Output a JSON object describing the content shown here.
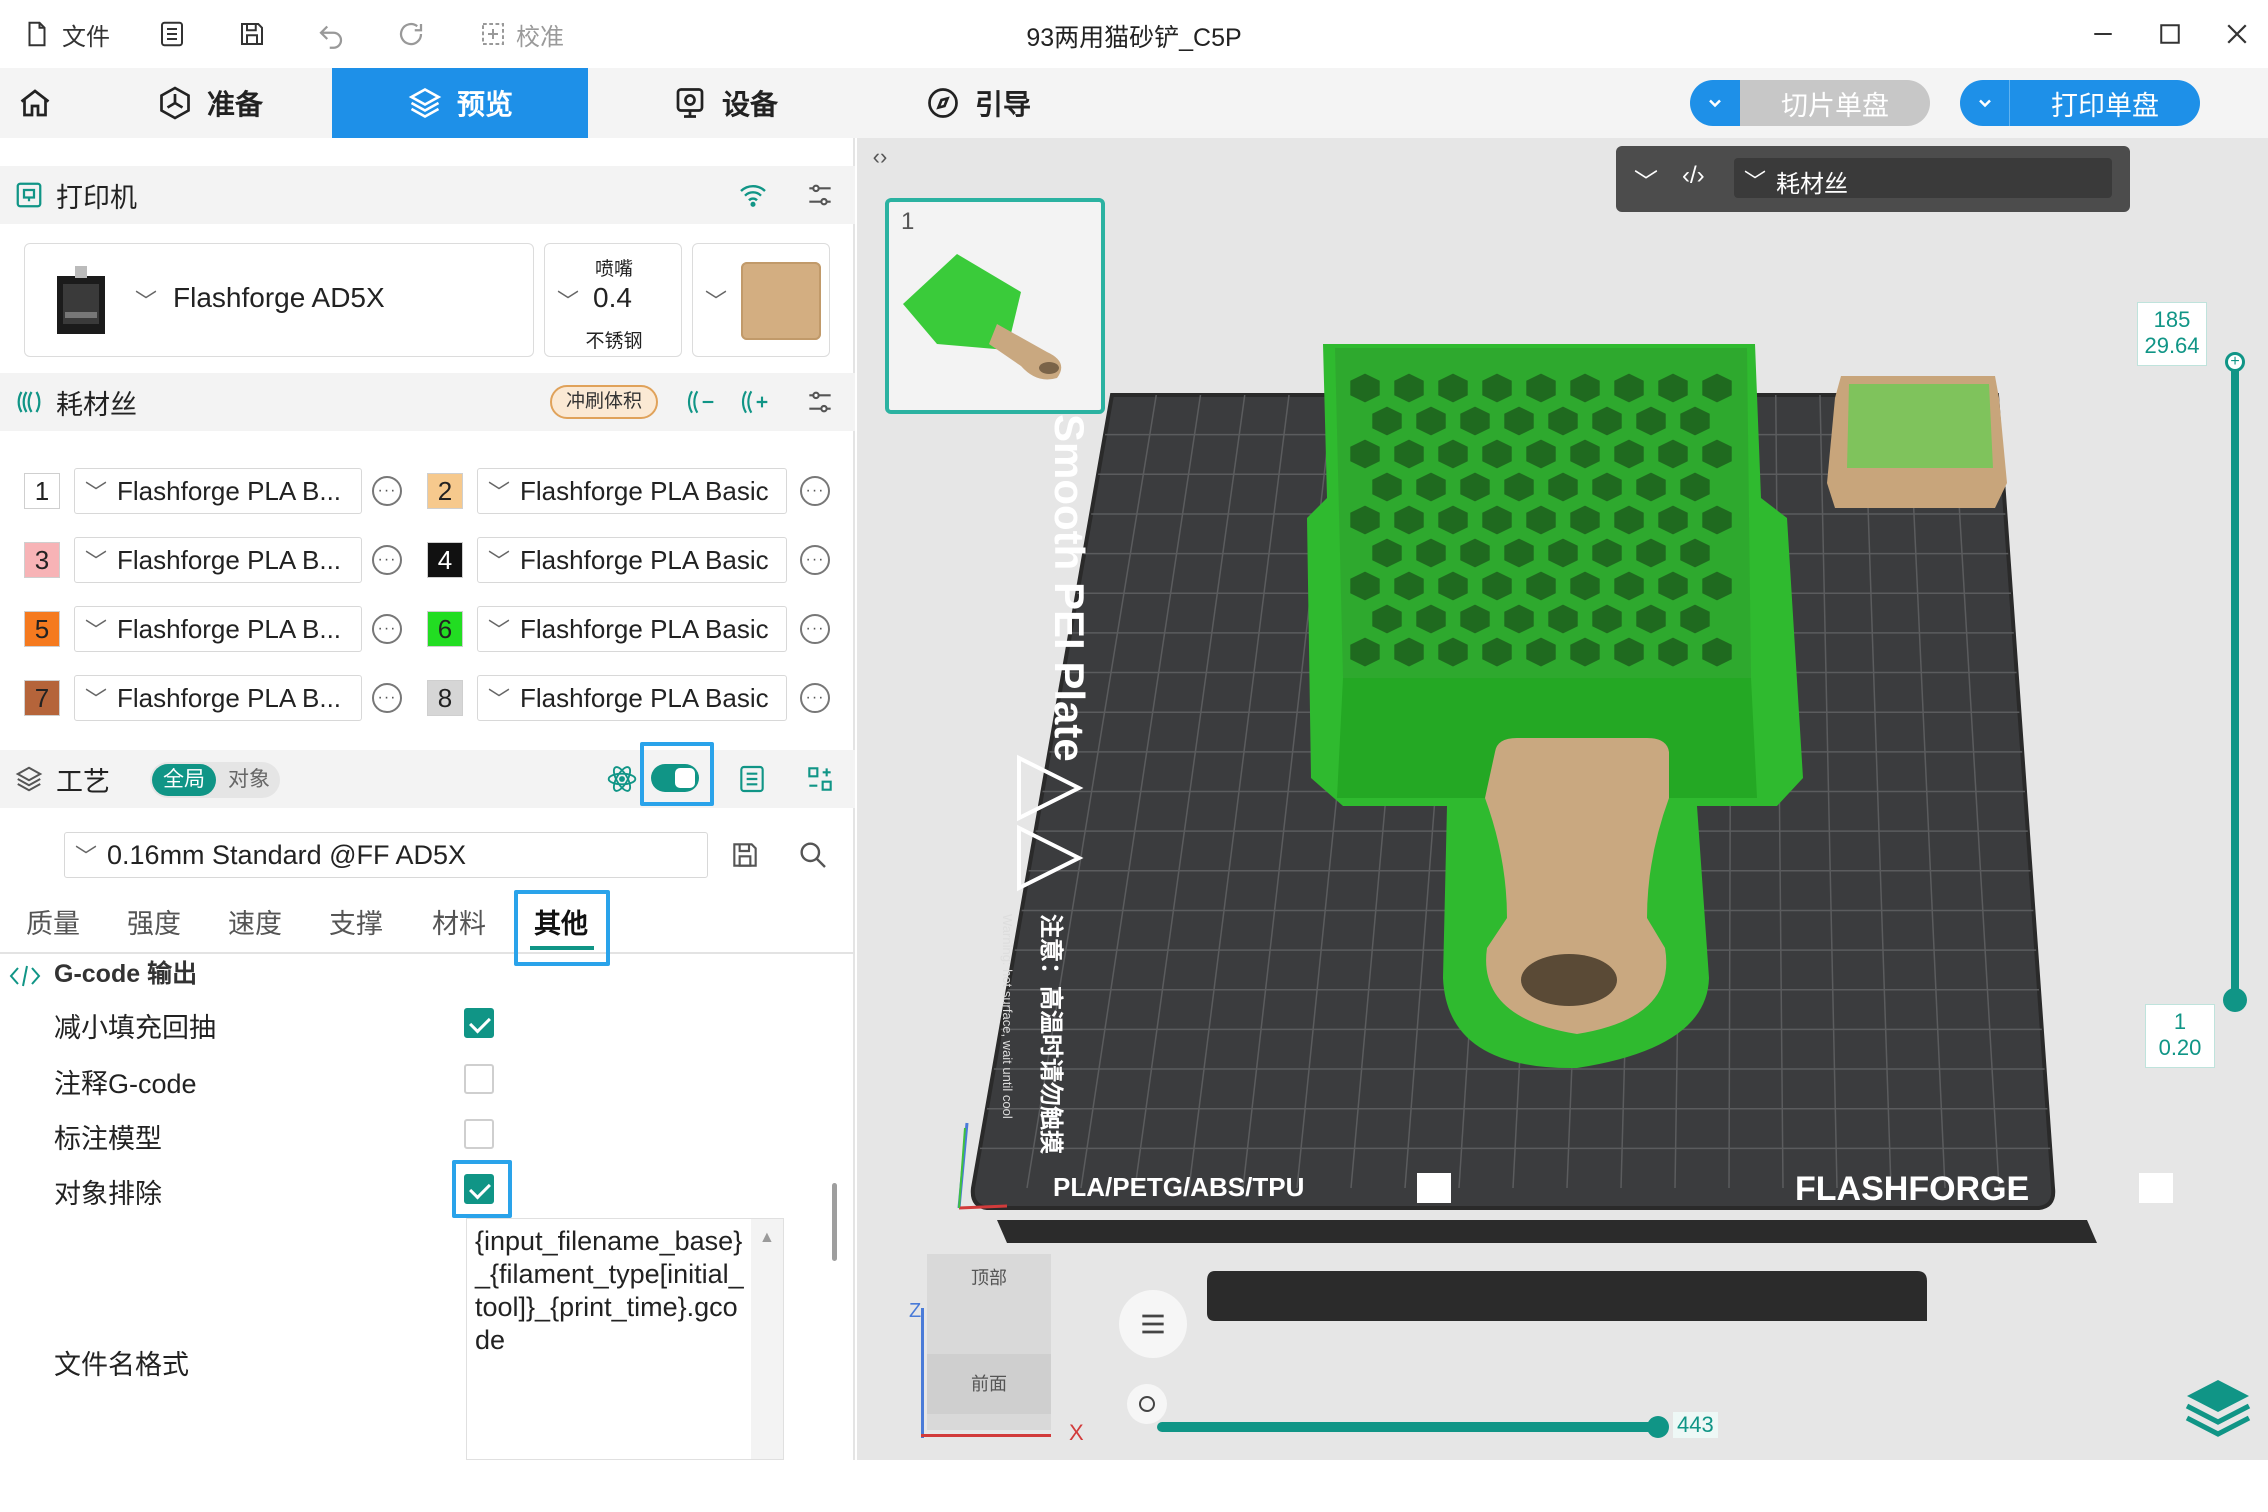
{
  "titlebar": {
    "file_label": "文件",
    "calibrate_label": "校准",
    "window_title": "93两用猫砂铲_C5P"
  },
  "nav": {
    "tabs": [
      {
        "label": "准备",
        "icon": "hexagon-icon"
      },
      {
        "label": "预览",
        "icon": "layers-icon",
        "active": true
      },
      {
        "label": "设备",
        "icon": "device-icon"
      },
      {
        "label": "引导",
        "icon": "compass-icon"
      }
    ],
    "slice_label": "切片单盘",
    "print_label": "打印单盘"
  },
  "printer": {
    "section_title": "打印机",
    "name": "Flashforge AD5X",
    "nozzle_caption": "喷嘴",
    "nozzle_size": "0.4",
    "nozzle_material": "不锈钢"
  },
  "filament": {
    "section_title": "耗材丝",
    "flush_button": "冲刷体积",
    "slots": [
      {
        "num": "1",
        "name": "Flashforge PLA B...",
        "color": "#ffffff",
        "text": "#222222"
      },
      {
        "num": "2",
        "name": "Flashforge PLA Basic",
        "color": "#f6c98d",
        "text": "#222222"
      },
      {
        "num": "3",
        "name": "Flashforge PLA B...",
        "color": "#f7b3b6",
        "text": "#222222"
      },
      {
        "num": "4",
        "name": "Flashforge PLA Basic",
        "color": "#111111",
        "text": "#ffffff"
      },
      {
        "num": "5",
        "name": "Flashforge PLA B...",
        "color": "#f57a1f",
        "text": "#222222"
      },
      {
        "num": "6",
        "name": "Flashforge PLA Basic",
        "color": "#22dd22",
        "text": "#222222"
      },
      {
        "num": "7",
        "name": "Flashforge PLA B...",
        "color": "#b5643a",
        "text": "#222222"
      },
      {
        "num": "8",
        "name": "Flashforge PLA Basic",
        "color": "#d6d6d6",
        "text": "#222222"
      }
    ]
  },
  "process": {
    "section_title": "工艺",
    "toggle_global": "全局",
    "toggle_object": "对象",
    "preset": "0.16mm Standard @FF AD5X",
    "tabs": [
      "质量",
      "强度",
      "速度",
      "支撑",
      "材料",
      "其他"
    ],
    "active_tab": "其他",
    "group_title": "G-code 输出",
    "options": [
      {
        "label": "减小填充回抽",
        "checked": true
      },
      {
        "label": "注释G-code",
        "checked": false
      },
      {
        "label": "标注模型",
        "checked": false
      },
      {
        "label": "对象排除",
        "checked": true
      }
    ],
    "filename_label": "文件名格式",
    "filename_value": "{input_filename_base}_{filament_type[initial_tool]}_{print_time}.gcode"
  },
  "viewport": {
    "dropdown_label": "耗材丝",
    "thumbnail_index": "1",
    "layer_top_num": "185",
    "layer_top_height": "29.64",
    "layer_bottom_num": "1",
    "layer_bottom_height": "0.20",
    "move_value": "443",
    "cube_top": "顶部",
    "cube_front": "前面",
    "axis_x": "X",
    "axis_z": "Z",
    "plate_text": "Smooth PEI Plate",
    "plate_materials": "PLA/PETG/ABS/TPU",
    "plate_brand": "FLASHFORGE",
    "plate_warning_cn": "注意：高温时请勿触摸",
    "plate_warning_en": "Warning: hot surface, wait until cool"
  },
  "colors": {
    "accent": "#1e90e8",
    "teal": "#109586",
    "model_green": "#2fc12f",
    "model_tan": "#c6a57c"
  }
}
